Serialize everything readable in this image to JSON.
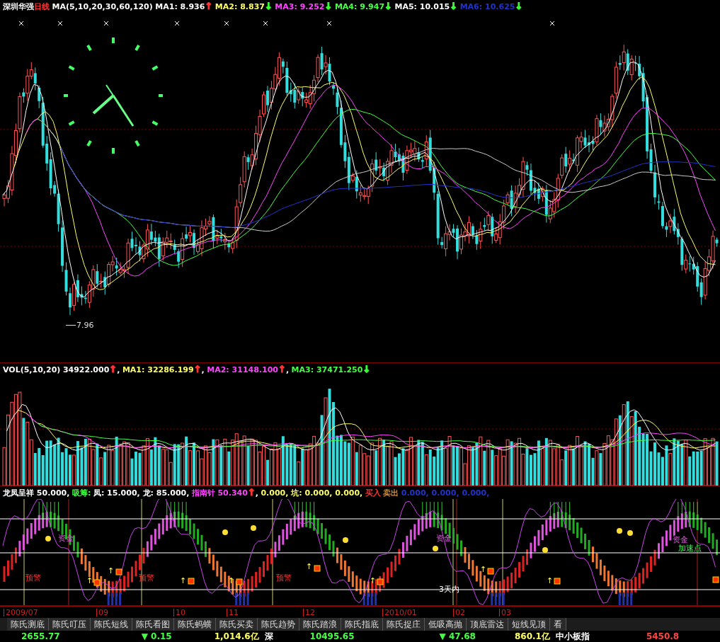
{
  "header": {
    "stock_name": "深圳华强",
    "period": "日线",
    "legend": [
      {
        "text": "MA(5,10,20,30,60,120)",
        "color": "#ffffff"
      },
      {
        "text": "MA1: 8.936",
        "color": "#ffffff"
      },
      {
        "text": "↑",
        "color": "#ff3333",
        "kind": "arrow"
      },
      {
        "text": "MA2: 8.837",
        "color": "#ffff66"
      },
      {
        "text": "↓",
        "color": "#33ff33",
        "kind": "arrow"
      },
      {
        "text": "MA3: 9.252",
        "color": "#ff44ff"
      },
      {
        "text": "↓",
        "color": "#33ff33",
        "kind": "arrow"
      },
      {
        "text": "MA4: 9.947",
        "color": "#44ff44"
      },
      {
        "text": "↓",
        "color": "#33ff33",
        "kind": "arrow"
      },
      {
        "text": "MA5: 10.015",
        "color": "#ffffff"
      },
      {
        "text": "↓",
        "color": "#33ff33",
        "kind": "arrow"
      },
      {
        "text": "MA6: 10.625",
        "color": "#2233cc"
      },
      {
        "text": "↓",
        "color": "#33ff33",
        "kind": "arrow"
      }
    ]
  },
  "price_chart": {
    "low_label": "7.96"
  },
  "volume": {
    "legend": [
      {
        "text": "VOL(5,10,20)",
        "color": "#ffffff"
      },
      {
        "text": "34922.000",
        "color": "#ffffff"
      },
      {
        "text": "↑",
        "color": "#ff3333",
        "kind": "arrow"
      },
      {
        "text": ",",
        "kind": "separator"
      },
      {
        "text": "MA1: 32286.199",
        "color": "#ffff66"
      },
      {
        "text": "↑",
        "color": "#ff3333",
        "kind": "arrow"
      },
      {
        "text": ",",
        "kind": "separator"
      },
      {
        "text": "MA2: 31148.100",
        "color": "#ff44ff"
      },
      {
        "text": "↑",
        "color": "#ff3333",
        "kind": "arrow"
      },
      {
        "text": ",",
        "kind": "separator"
      },
      {
        "text": "MA3: 37471.250",
        "color": "#44ff44"
      },
      {
        "text": "↓",
        "color": "#33ff33",
        "kind": "arrow"
      }
    ]
  },
  "indicator": {
    "legend": [
      {
        "text": "龙凤呈祥 50.000,",
        "color": "#ffffff"
      },
      {
        "text": "吸筹:",
        "color": "#44ff44"
      },
      {
        "text": "凤: 15.000, 龙: 85.000,",
        "color": "#ffffff"
      },
      {
        "text": "指南针",
        "color": "#ff44ff"
      },
      {
        "text": "50.340",
        "color": "#ff44ff"
      },
      {
        "text": "↑",
        "color": "#ff3333",
        "kind": "arrow"
      },
      {
        "text": ",",
        "kind": "separator"
      },
      {
        "text": "0.000, 坑: 0.000, 0.000,",
        "color": "#ffff66"
      },
      {
        "text": "买入",
        "color": "#ff3333"
      },
      {
        "text": "卖出",
        "color": "#cc8833"
      },
      {
        "text": "0.000, 0.000, 0.000,",
        "color": "#2233cc"
      }
    ],
    "labels": [
      {
        "text": "资金",
        "kind": "fund"
      },
      {
        "text": "资金",
        "kind": "fund"
      },
      {
        "text": "资金",
        "kind": "fund"
      },
      {
        "text": "加速点",
        "kind": "accel"
      },
      {
        "text": "预警",
        "kind": "warn"
      },
      {
        "text": "预警",
        "kind": "warn"
      },
      {
        "text": "预警",
        "kind": "warn"
      },
      {
        "text": "3天内",
        "kind": "days"
      },
      {
        "text": "↑",
        "kind": "arrow"
      },
      {
        "text": "↑",
        "kind": "arrow"
      },
      {
        "text": "↑",
        "kind": "arrow"
      },
      {
        "text": "↑",
        "kind": "arrow"
      },
      {
        "text": "↑",
        "kind": "arrow"
      },
      {
        "text": "↑",
        "kind": "arrow"
      },
      {
        "text": "↑",
        "kind": "arrow"
      },
      {
        "text": "↑",
        "kind": "arrow"
      }
    ]
  },
  "date_axis": [
    "2009/07",
    "09",
    "10",
    "11",
    "12",
    "2010/01",
    "02",
    "03"
  ],
  "tabs": [
    {
      "label": "陈氏测底",
      "selected": false
    },
    {
      "label": "陈氏叮压",
      "selected": false
    },
    {
      "label": "陈氏短线",
      "selected": false
    },
    {
      "label": "陈氏看图",
      "selected": false
    },
    {
      "label": "陈氏蚂蟥",
      "selected": false
    },
    {
      "label": "陈氏买卖",
      "selected": false
    },
    {
      "label": "陈氏趋势",
      "selected": false
    },
    {
      "label": "陈氏踏浪",
      "selected": false
    },
    {
      "label": "陈氏指底",
      "selected": false
    },
    {
      "label": "陈氏捉庄",
      "selected": false
    },
    {
      "label": "低吸高抛",
      "selected": false
    },
    {
      "label": "顶底雷达",
      "selected": false
    },
    {
      "label": "短线见顶",
      "selected": false
    },
    {
      "label": "看",
      "selected": false
    }
  ],
  "status_bar": [
    {
      "text": "2655.77",
      "color": "#44ff44"
    },
    {
      "text": "▼ 0.15",
      "color": "#44ff44"
    },
    {
      "text": "1,014.6亿",
      "color": "#ffff66"
    },
    {
      "text": "深",
      "color": "#ffffff"
    },
    {
      "text": "10495.65",
      "color": "#44ff44"
    },
    {
      "text": "▼ 47.68",
      "color": "#44ff44"
    },
    {
      "text": "860.1亿",
      "color": "#ffff66"
    },
    {
      "text": "中小板指",
      "color": "#ffffff"
    },
    {
      "text": "5450.8",
      "color": "#ff4444"
    }
  ]
}
